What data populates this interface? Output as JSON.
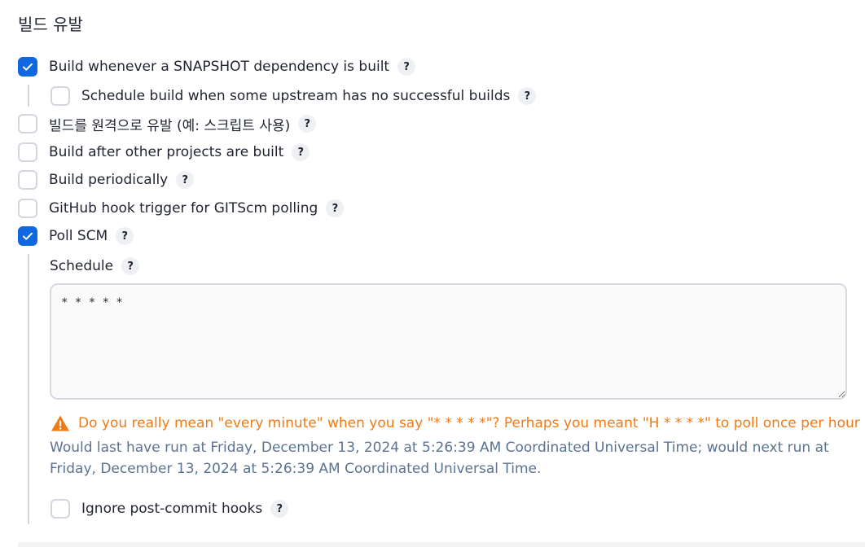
{
  "section": {
    "title": "빌드 유발"
  },
  "help_glyph": "?",
  "triggers": {
    "snapshot": {
      "label": "Build whenever a SNAPSHOT dependency is built",
      "checked": true
    },
    "upstream": {
      "label": "Schedule build when some upstream has no successful builds",
      "checked": false
    },
    "remote": {
      "label": "빌드를 원격으로 유발 (예: 스크립트 사용)",
      "checked": false
    },
    "after_other": {
      "label": "Build after other projects are built",
      "checked": false
    },
    "periodic": {
      "label": "Build periodically",
      "checked": false
    },
    "github_hook": {
      "label": "GitHub hook trigger for GITScm polling",
      "checked": false
    },
    "poll_scm": {
      "label": "Poll SCM",
      "checked": true
    },
    "ignore_hooks": {
      "label": "Ignore post-commit hooks",
      "checked": false
    }
  },
  "schedule": {
    "label": "Schedule",
    "value": "* * * * *",
    "warning": "Do you really mean \"every minute\" when you say \"* * * * *\"? Perhaps you meant \"H * * * *\" to poll once per hour",
    "info": "Would last have run at Friday, December 13, 2024 at 5:26:39 AM Coordinated Universal Time; would next run at Friday, December 13, 2024 at 5:26:39 AM Coordinated Universal Time."
  },
  "colors": {
    "accent": "#1068e0",
    "warning": "#f07a16",
    "info": "#5b7392"
  }
}
